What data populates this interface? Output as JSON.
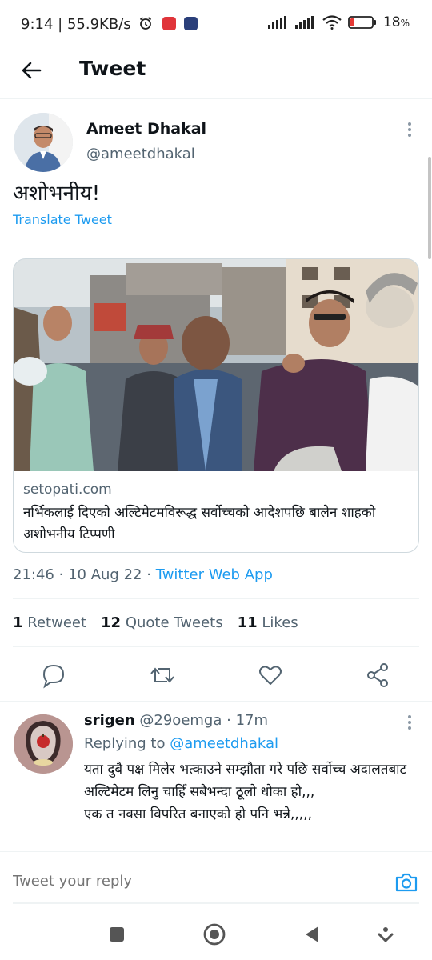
{
  "status_bar": {
    "time": "9:14",
    "network_speed": "55.9KB/s",
    "battery": "18",
    "battery_unit": "%",
    "battery_level": 0.18
  },
  "header": {
    "title": "Tweet"
  },
  "tweet": {
    "author_name": "Ameet Dhakal",
    "author_handle": "@ameetdhakal",
    "text": "अशोभनीय!",
    "translate_label": "Translate Tweet",
    "card": {
      "domain": "setopati.com",
      "title": "नर्भिकलाई दिएको अल्टिमेटमविरूद्ध सर्वोच्चको आदेशपछि बालेन शाहको अशोभनीय टिप्पणी"
    },
    "time": "21:46",
    "date": "10 Aug 22",
    "separator": "·",
    "source": "Twitter Web App",
    "stats": {
      "retweets_count": "1",
      "retweets_label": "Retweet",
      "quotes_count": "12",
      "quotes_label": "Quote Tweets",
      "likes_count": "11",
      "likes_label": "Likes"
    }
  },
  "reply": {
    "author_name": "srigen",
    "author_handle": "@29oemga",
    "separator": "·",
    "age": "17m",
    "replying_prefix": "Replying to",
    "replying_to": "@ameetdhakal",
    "text": "यता दुबै पक्ष मिलेर भत्काउने सम्झौता गरे पछि सर्वोच्च अदालतबाट अल्टिमेटम लिनु चाहिँ सबैभन्दा ठूलो धोका हो,,,\n   एक त नक्सा विपरित बनाएको हो पनि भन्ने,,,,,"
  },
  "compose": {
    "placeholder": "Tweet your reply"
  },
  "colors": {
    "accent": "#1d9bf0",
    "text_primary": "#0f1419",
    "text_secondary": "#536471",
    "border": "#cfd9de"
  },
  "icons": {
    "back": "arrow-left-icon",
    "more": "more-vertical-icon",
    "reply": "comment-icon",
    "retweet": "retweet-icon",
    "like": "heart-icon",
    "share": "share-icon",
    "camera": "camera-icon"
  }
}
